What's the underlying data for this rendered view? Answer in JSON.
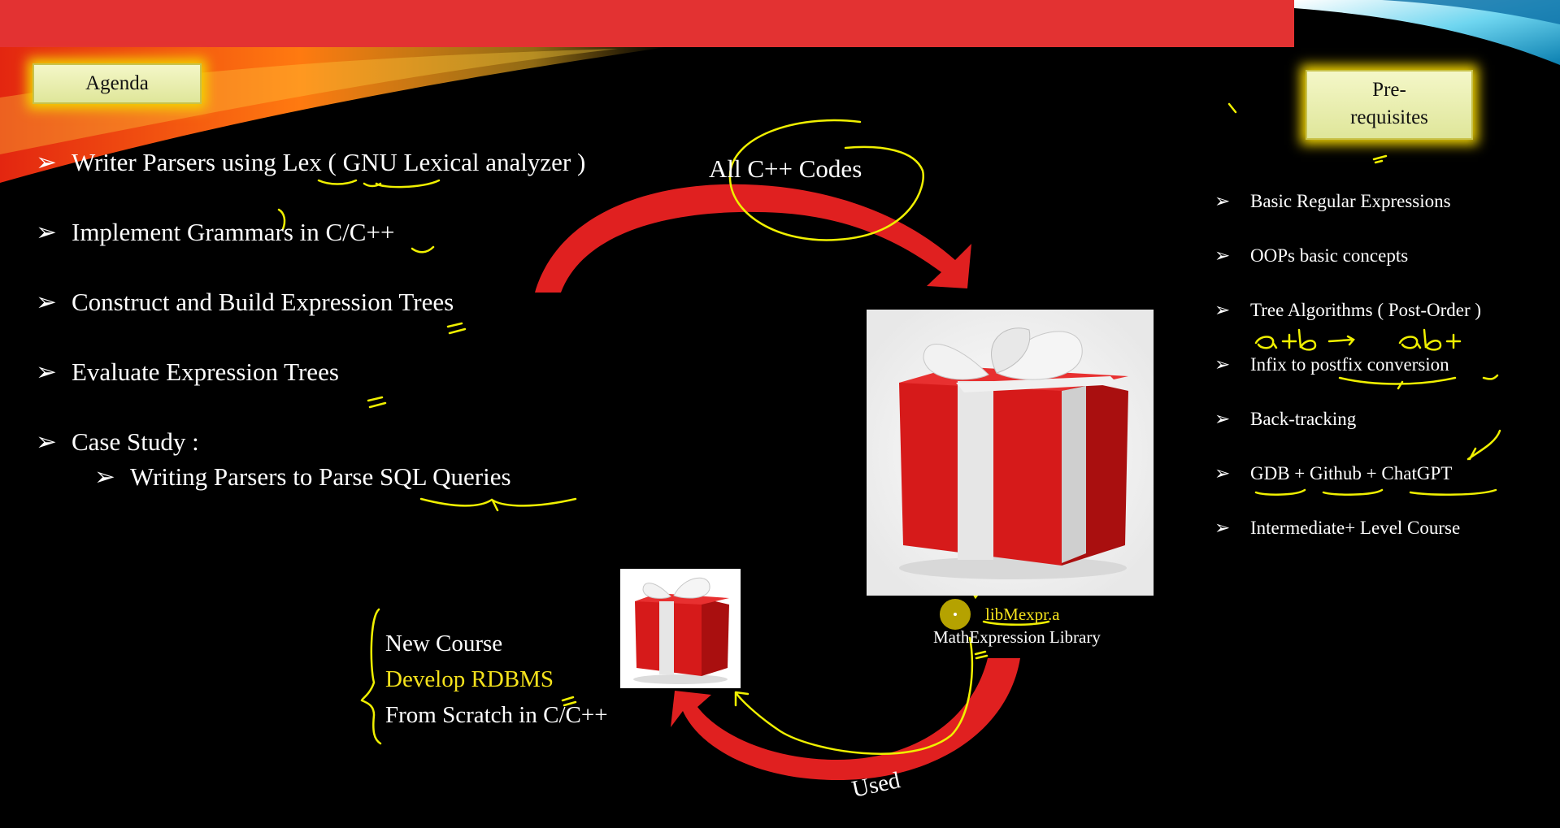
{
  "slide": {
    "agenda_label": "Agenda",
    "prereq_label_line1": "Pre-",
    "prereq_label_line2": "requisites"
  },
  "bullet_glyph": "➢",
  "agenda": {
    "items": [
      "Writer Parsers using Lex ( GNU Lexical analyzer )",
      "Implement Grammars in C/C++",
      "Construct and Build Expression Trees",
      "Evaluate Expression Trees",
      "Case Study :"
    ],
    "sub_item": "Writing Parsers to Parse SQL Queries"
  },
  "prerequisites": {
    "items": [
      "Basic Regular Expressions",
      "OOPs basic concepts",
      "Tree Algorithms ( Post-Order )",
      "Infix to postfix conversion",
      "Back-tracking",
      "GDB + Github + ChatGPT",
      "Intermediate+ Level Course"
    ]
  },
  "diagram": {
    "all_code_label": "All C++ Codes",
    "library_file": "libMexpr.a",
    "library_name": "MathExpression Library",
    "used_label": "Used",
    "new_course_line1": "New Course",
    "new_course_line2": "Develop RDBMS",
    "new_course_line3": "From Scratch in C/C++"
  },
  "annotations": {
    "handwritten_note": "a+b → ab+"
  },
  "colors": {
    "accent_red": "#e03030",
    "highlight_yellow": "#f5e21c",
    "ink_yellow": "#f0f000"
  }
}
